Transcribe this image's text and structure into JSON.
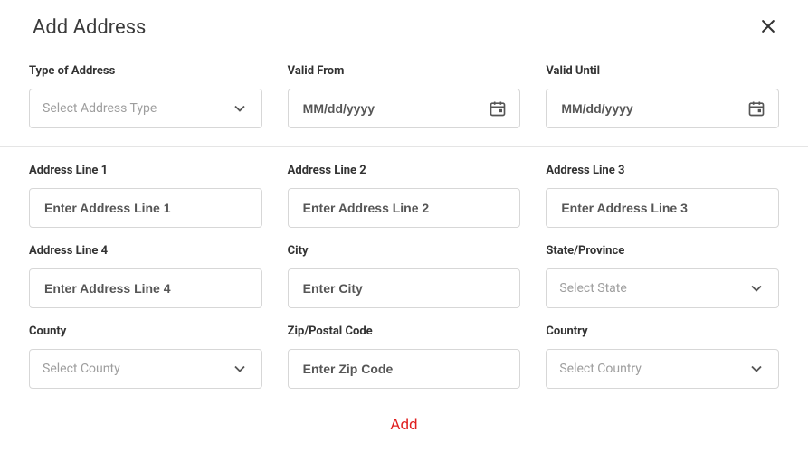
{
  "title": "Add Address",
  "top": {
    "type_label": "Type of Address",
    "type_placeholder": "Select Address Type",
    "valid_from_label": "Valid From",
    "valid_from_placeholder": "MM/dd/yyyy",
    "valid_until_label": "Valid Until",
    "valid_until_placeholder": "MM/dd/yyyy"
  },
  "addr": {
    "line1_label": "Address Line 1",
    "line1_placeholder": "Enter Address Line 1",
    "line2_label": "Address Line 2",
    "line2_placeholder": "Enter Address Line 2",
    "line3_label": "Address Line 3",
    "line3_placeholder": "Enter Address Line 3",
    "line4_label": "Address Line 4",
    "line4_placeholder": "Enter Address Line 4",
    "city_label": "City",
    "city_placeholder": "Enter City",
    "state_label": "State/Province",
    "state_placeholder": "Select State",
    "county_label": "County",
    "county_placeholder": "Select County",
    "zip_label": "Zip/Postal Code",
    "zip_placeholder": "Enter Zip Code",
    "country_label": "Country",
    "country_placeholder": "Select Country"
  },
  "footer": {
    "add_label": "Add"
  }
}
